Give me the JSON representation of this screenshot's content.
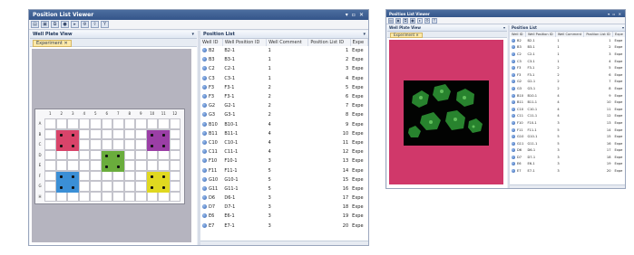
{
  "app_title": "Position List Viewer",
  "left_pane_title": "Well Plate View",
  "right_pane_title": "Position List",
  "tab_label": "Experiment",
  "toolbar_icons": [
    "open-icon",
    "save-icon",
    "copy-icon",
    "record-icon",
    "play-icon",
    "settings-icon",
    "export-icon",
    "filter-icon"
  ],
  "plate_cols": [
    "1",
    "2",
    "3",
    "4",
    "5",
    "6",
    "7",
    "8",
    "9",
    "10",
    "11",
    "12"
  ],
  "plate_rows": [
    "A",
    "B",
    "C",
    "D",
    "E",
    "F",
    "G",
    "H"
  ],
  "blocks": [
    {
      "color": "#d9446a",
      "name": "red"
    },
    {
      "color": "#9b3fa6",
      "name": "purple"
    },
    {
      "color": "#6aad3c",
      "name": "green"
    },
    {
      "color": "#3b8fd6",
      "name": "blue"
    },
    {
      "color": "#e0d820",
      "name": "yellow"
    }
  ],
  "columns": [
    "Well ID",
    "Well Position ID",
    "Well Comment",
    "Position List ID",
    "Expe"
  ],
  "rows": [
    {
      "well": "B2",
      "pos": "B2-1",
      "comment": "1",
      "id": "1",
      "expe": "Expe"
    },
    {
      "well": "B3",
      "pos": "B3-1",
      "comment": "1",
      "id": "2",
      "expe": "Expe"
    },
    {
      "well": "C2",
      "pos": "C2-1",
      "comment": "1",
      "id": "3",
      "expe": "Expe"
    },
    {
      "well": "C3",
      "pos": "C3-1",
      "comment": "1",
      "id": "4",
      "expe": "Expe"
    },
    {
      "well": "F3",
      "pos": "F3-1",
      "comment": "2",
      "id": "5",
      "expe": "Expe"
    },
    {
      "well": "F3",
      "pos": "F3-1",
      "comment": "2",
      "id": "6",
      "expe": "Expe"
    },
    {
      "well": "G2",
      "pos": "G2-1",
      "comment": "2",
      "id": "7",
      "expe": "Expe"
    },
    {
      "well": "G3",
      "pos": "G3-1",
      "comment": "2",
      "id": "8",
      "expe": "Expe"
    },
    {
      "well": "B10",
      "pos": "B10-1",
      "comment": "4",
      "id": "9",
      "expe": "Expe"
    },
    {
      "well": "B11",
      "pos": "B11-1",
      "comment": "4",
      "id": "10",
      "expe": "Expe"
    },
    {
      "well": "C10",
      "pos": "C10-1",
      "comment": "4",
      "id": "11",
      "expe": "Expe"
    },
    {
      "well": "C11",
      "pos": "C11-1",
      "comment": "4",
      "id": "12",
      "expe": "Expe"
    },
    {
      "well": "F10",
      "pos": "F10-1",
      "comment": "3",
      "id": "13",
      "expe": "Expe"
    },
    {
      "well": "F11",
      "pos": "F11-1",
      "comment": "5",
      "id": "14",
      "expe": "Expe"
    },
    {
      "well": "G10",
      "pos": "G10-1",
      "comment": "5",
      "id": "15",
      "expe": "Expe"
    },
    {
      "well": "G11",
      "pos": "G11-1",
      "comment": "5",
      "id": "16",
      "expe": "Expe"
    },
    {
      "well": "D6",
      "pos": "D6-1",
      "comment": "3",
      "id": "17",
      "expe": "Expe"
    },
    {
      "well": "D7",
      "pos": "D7-1",
      "comment": "3",
      "id": "18",
      "expe": "Expe"
    },
    {
      "well": "E6",
      "pos": "E6-1",
      "comment": "3",
      "id": "19",
      "expe": "Expe"
    },
    {
      "well": "E7",
      "pos": "E7-1",
      "comment": "3",
      "id": "20",
      "expe": "Expe"
    }
  ],
  "image_bg": "#d0386a",
  "cell_color": "#2f9a36"
}
